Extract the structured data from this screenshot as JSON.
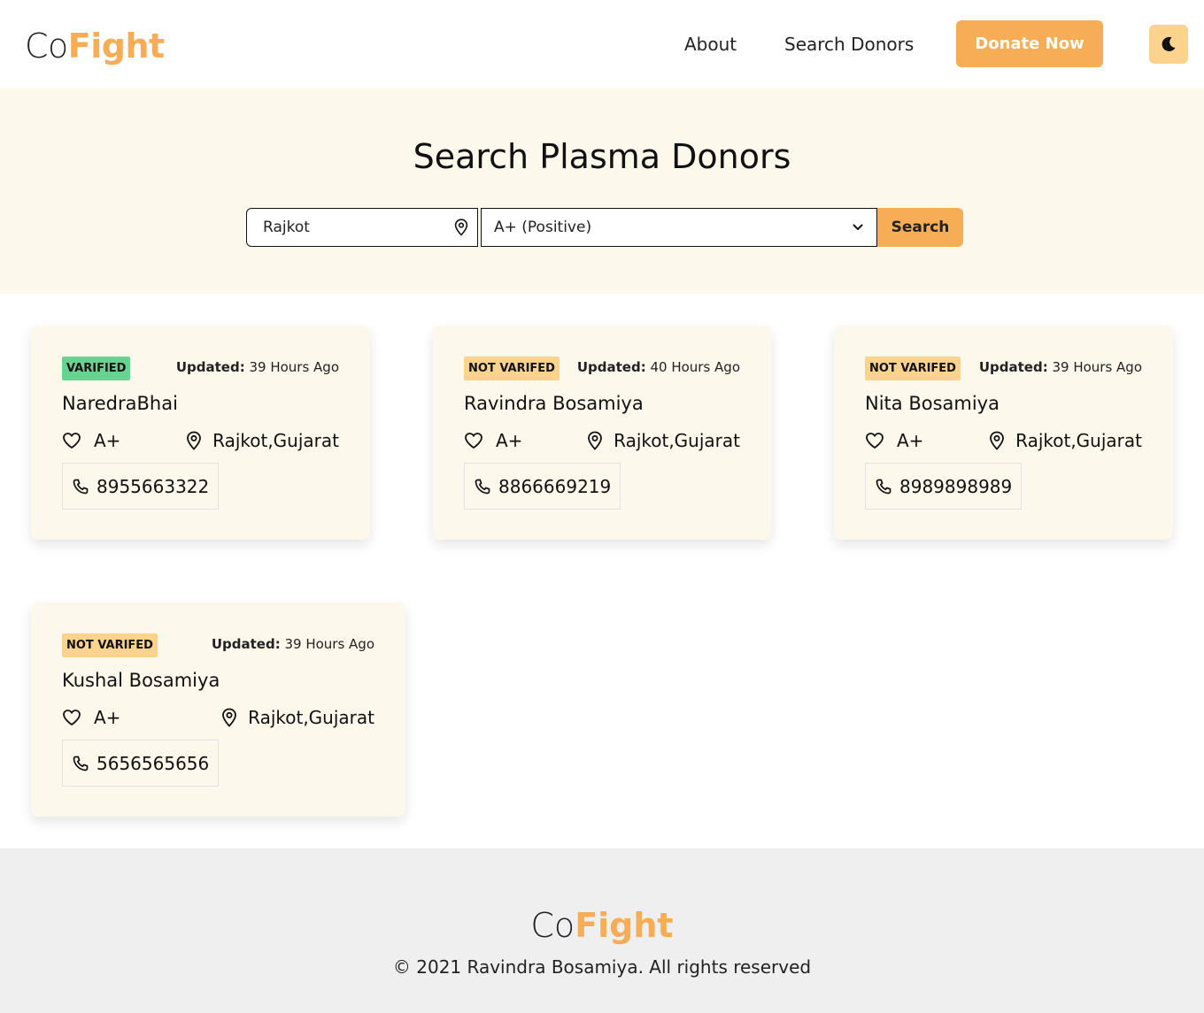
{
  "brand": {
    "prefix": "Co",
    "highlight": "Fight"
  },
  "nav": {
    "about": "About",
    "search_donors": "Search Donors",
    "donate_now": "Donate Now"
  },
  "theme_toggle_icon": "moon-icon",
  "hero": {
    "title": "Search Plasma Donors",
    "location_value": "Rajkot",
    "blood_group_selected": "A+ (Positive)",
    "search_label": "Search"
  },
  "labels": {
    "updated": "Updated:"
  },
  "donors": [
    {
      "status": "VARIFIED",
      "verified": true,
      "updated": " 39 Hours Ago",
      "name": "NaredraBhai",
      "blood": "A+",
      "location": "Rajkot,Gujarat",
      "phone": "8955663322"
    },
    {
      "status": "NOT VARIFED",
      "verified": false,
      "updated": " 40 Hours Ago",
      "name": "Ravindra Bosamiya",
      "blood": "A+",
      "location": "Rajkot,Gujarat",
      "phone": "8866669219"
    },
    {
      "status": "NOT VARIFED",
      "verified": false,
      "updated": " 39 Hours Ago",
      "name": "Nita Bosamiya",
      "blood": "A+",
      "location": "Rajkot,Gujarat",
      "phone": "8989898989"
    },
    {
      "status": "NOT VARIFED",
      "verified": false,
      "updated": " 39 Hours Ago",
      "name": "Kushal Bosamiya",
      "blood": "A+",
      "location": "Rajkot,Gujarat",
      "phone": "5656565656"
    }
  ],
  "footer": {
    "copyright": "© 2021 Ravindra Bosamiya. All rights reserved"
  },
  "colors": {
    "accent": "#f6ad55",
    "accent_light": "#fbd38d",
    "verified": "#68d391",
    "hero_bg": "#fdf8ec",
    "footer_bg": "#efefef"
  }
}
